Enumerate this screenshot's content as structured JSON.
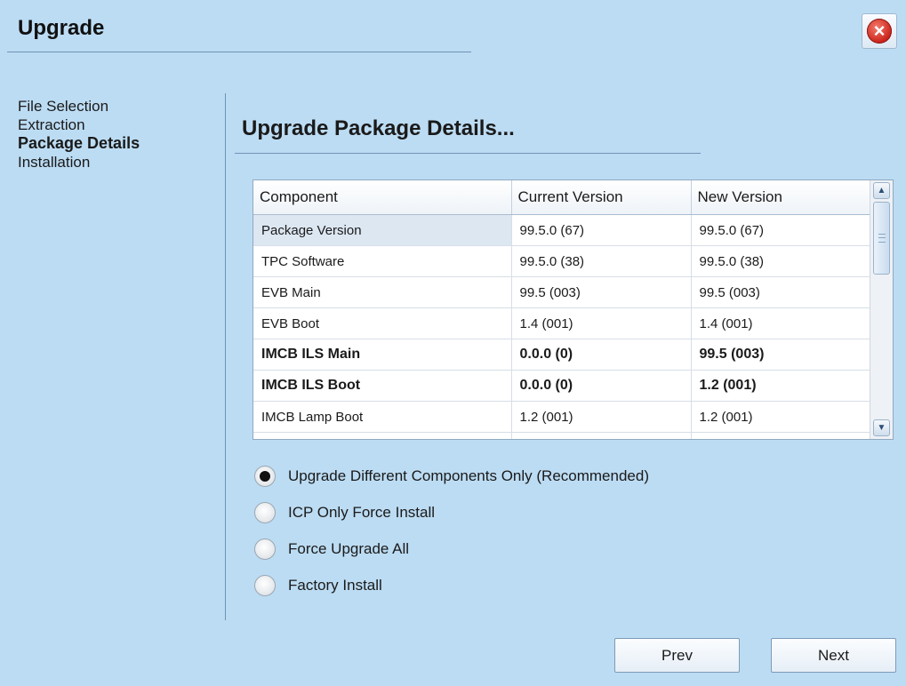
{
  "window": {
    "title": "Upgrade",
    "close_icon": "close-icon"
  },
  "steps": [
    {
      "label": "File Selection",
      "active": false
    },
    {
      "label": "Extraction",
      "active": false
    },
    {
      "label": "Package Details",
      "active": true
    },
    {
      "label": "Installation",
      "active": false
    }
  ],
  "section": {
    "title": "Upgrade Package Details..."
  },
  "table": {
    "columns": [
      "Component",
      "Current Version",
      "New Version"
    ],
    "rows": [
      {
        "component": "Package Version",
        "current": "99.5.0 (67)",
        "new": "99.5.0 (67)",
        "bold": false,
        "selected": true
      },
      {
        "component": "TPC Software",
        "current": "99.5.0 (38)",
        "new": "99.5.0 (38)",
        "bold": false,
        "selected": false
      },
      {
        "component": "EVB Main",
        "current": "99.5 (003)",
        "new": "99.5 (003)",
        "bold": false,
        "selected": false
      },
      {
        "component": "EVB Boot",
        "current": "1.4 (001)",
        "new": "1.4 (001)",
        "bold": false,
        "selected": false
      },
      {
        "component": "IMCB ILS Main",
        "current": "0.0.0 (0)",
        "new": "99.5 (003)",
        "bold": true,
        "selected": false
      },
      {
        "component": "IMCB ILS Boot",
        "current": "0.0.0 (0)",
        "new": "1.2 (001)",
        "bold": true,
        "selected": false
      },
      {
        "component": "IMCB Lamp Boot",
        "current": "1.2 (001)",
        "new": "1.2 (001)",
        "bold": false,
        "selected": false
      }
    ]
  },
  "options": [
    {
      "label": "Upgrade Different Components Only (Recommended)",
      "checked": true
    },
    {
      "label": "ICP Only Force Install",
      "checked": false
    },
    {
      "label": "Force Upgrade All",
      "checked": false
    },
    {
      "label": "Factory Install",
      "checked": false
    }
  ],
  "buttons": {
    "prev": "Prev",
    "next": "Next"
  }
}
